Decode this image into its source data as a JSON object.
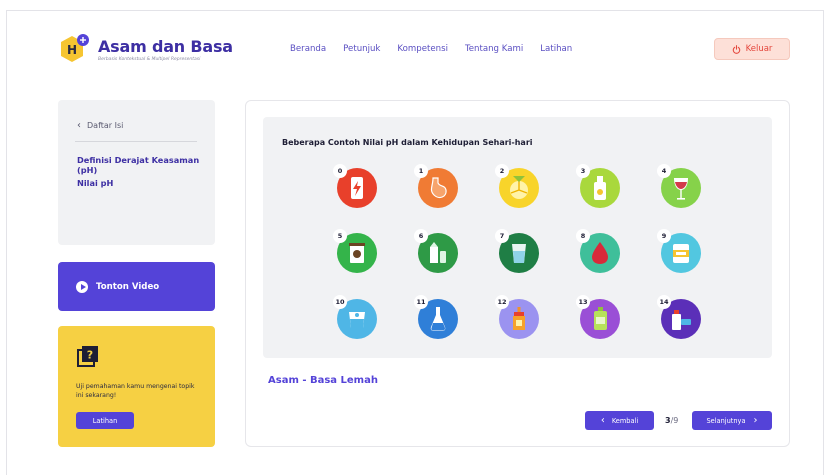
{
  "header": {
    "app_title": "Asam dan Basa",
    "app_tagline": "Berbasis Kontekstual & Multipel Representasi",
    "logo_letter": "H",
    "nav": [
      "Beranda",
      "Petunjuk",
      "Kompetensi",
      "Tentang Kami",
      "Latihan"
    ],
    "logout_label": "Keluar"
  },
  "sidebar": {
    "back_label": "Daftar Isi",
    "items": [
      "Definisi Derajat Keasaman (pH)",
      "Nilai pH"
    ],
    "video_label": "Tonton Video",
    "quiz_text": "Uji pemahaman kamu mengenai topik ini sekarang!",
    "quiz_button": "Latihan"
  },
  "main": {
    "panel_title": "Beberapa Contoh Nilai pH dalam Kehidupan Sehari-hari",
    "section_title": "Asam - Basa Lemah",
    "back_button": "Kembali",
    "next_button": "Selanjutnya",
    "page_current": "3",
    "page_total": "/9"
  },
  "ph_items": [
    {
      "num": "0",
      "color": "#e8402b",
      "icon": "battery-icon"
    },
    {
      "num": "1",
      "color": "#f07b34",
      "icon": "stomach-icon"
    },
    {
      "num": "2",
      "color": "#f8d42a",
      "icon": "lemon-icon"
    },
    {
      "num": "3",
      "color": "#a9d83c",
      "icon": "bottle-icon"
    },
    {
      "num": "4",
      "color": "#86d24a",
      "icon": "wine-glass-icon"
    },
    {
      "num": "5",
      "color": "#34b44a",
      "icon": "coffee-cup-icon"
    },
    {
      "num": "6",
      "color": "#2e9a46",
      "icon": "milk-icon"
    },
    {
      "num": "7",
      "color": "#1f7e45",
      "icon": "water-glass-icon"
    },
    {
      "num": "8",
      "color": "#3fbf9a",
      "icon": "blood-drop-icon"
    },
    {
      "num": "9",
      "color": "#52c7e0",
      "icon": "baking-soda-icon"
    },
    {
      "num": "10",
      "color": "#4fb6e6",
      "icon": "antacid-icon"
    },
    {
      "num": "11",
      "color": "#2f7fd8",
      "icon": "flask-icon"
    },
    {
      "num": "12",
      "color": "#9b93f0",
      "icon": "soap-icon"
    },
    {
      "num": "13",
      "color": "#9a4fd6",
      "icon": "bleach-icon"
    },
    {
      "num": "14",
      "color": "#5b2fb8",
      "icon": "drain-cleaner-icon"
    }
  ],
  "colors": {
    "brand": "#5443d8",
    "brand_dark": "#3d2fa3",
    "logo_yellow": "#f6c531",
    "logout_bg": "#fde0d8",
    "quiz_bg": "#f6d043"
  }
}
